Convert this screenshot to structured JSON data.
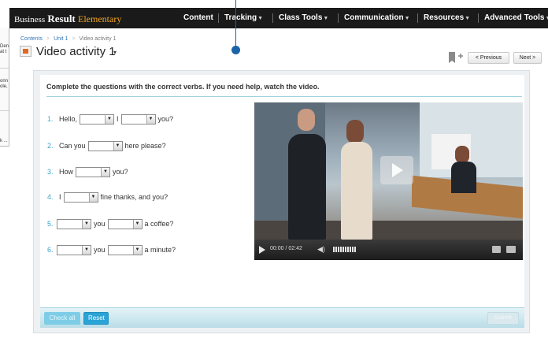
{
  "left_panel": {
    "line1": "Den",
    "line2": "at t",
    "line3": "onn",
    "line4": "ole,",
    "line5": "k ..."
  },
  "topbar": {
    "brand": {
      "part1": "Business",
      "part2": "Result",
      "part3": "Elementary"
    },
    "menu": [
      {
        "label": "Content",
        "has_caret": false
      },
      {
        "label": "Tracking",
        "has_caret": true
      },
      {
        "label": "Class Tools",
        "has_caret": true
      },
      {
        "label": "Communication",
        "has_caret": true
      },
      {
        "label": "Resources",
        "has_caret": true
      },
      {
        "label": "Advanced Tools",
        "has_caret": true
      }
    ]
  },
  "breadcrumb": {
    "items": [
      "Contents",
      "Unit 1",
      "Video activity 1"
    ]
  },
  "page": {
    "title": "Video activity 1",
    "title_caret": "▾",
    "prev_label": "< Previous",
    "next_label": "Next >"
  },
  "activity": {
    "instruction": "Complete the questions with the correct verbs. If you need help, watch the video.",
    "questions": [
      {
        "num": "1.",
        "t1": "Hello,",
        "t2": "I",
        "t3": "you?"
      },
      {
        "num": "2.",
        "t1": "Can you",
        "t2": "here please?"
      },
      {
        "num": "3.",
        "t1": "How",
        "t2": "you?"
      },
      {
        "num": "4.",
        "t1": "I",
        "t2": "fine thanks, and you?"
      },
      {
        "num": "5.",
        "t1": "you",
        "t2": "a coffee?"
      },
      {
        "num": "6.",
        "t1": "you",
        "t2": "a minute?"
      }
    ]
  },
  "video": {
    "time": "00:00 / 02:42"
  },
  "footer": {
    "check_label": "Check all",
    "reset_label": "Reset",
    "submit_label": "Submit"
  },
  "colors": {
    "topbar": "#1a1a1a",
    "accent_blue": "#2aa3d6",
    "callout": "#1b63a8",
    "brand_accent": "#f5a623"
  }
}
